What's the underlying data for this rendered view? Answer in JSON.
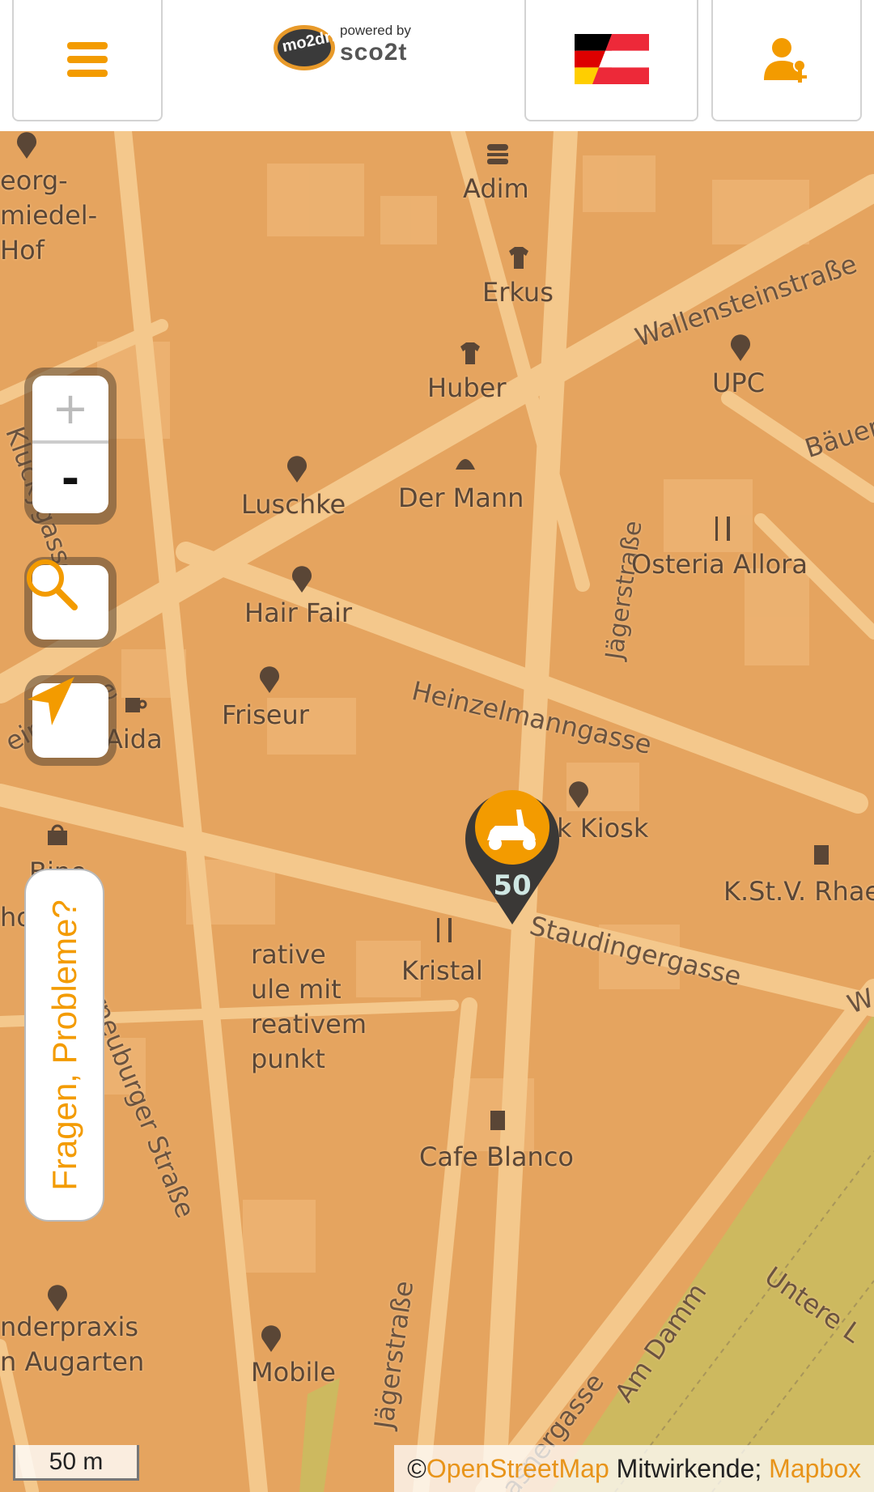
{
  "topbar": {
    "menu_icon": "hamburger-menu-icon",
    "logo": {
      "brand": "mo2drive",
      "powered_by": "powered by",
      "partner": "sco2t"
    },
    "language_icon": "flag-de-at-icon",
    "account_icon": "user-key-icon"
  },
  "colors": {
    "accent": "#f39b00",
    "map_block": "#e5a45f",
    "map_road": "#f4c88c",
    "park": "#cdb95f"
  },
  "map": {
    "pois": [
      {
        "name": "Adim"
      },
      {
        "name": "Erkus"
      },
      {
        "name": "Huber"
      },
      {
        "name": "UPC"
      },
      {
        "name": "Luschke"
      },
      {
        "name": "Der Mann"
      },
      {
        "name": "Osteria Allora"
      },
      {
        "name": "Hair Fair"
      },
      {
        "name": "Friseur"
      },
      {
        "name": "Aida"
      },
      {
        "name": "k Kiosk"
      },
      {
        "name": "K.St.V. Rhae"
      },
      {
        "name": "Kristal"
      },
      {
        "name": "Cafe Blanco"
      },
      {
        "name": "Mobile"
      }
    ],
    "text_fragments": {
      "georg": "eorg-\nmiedel-\nHof",
      "kreative": "rative\nule mit\nreativem\npunkt",
      "kinderpraxis": "nderpraxis\nn Augarten",
      "bine": "Bine",
      "ho": "ho"
    },
    "streets": {
      "wallenstein": "Wallensteinstraße",
      "baeuerle": "Bäuer",
      "jaeger1": "Jägerstraße",
      "jaeger2": "Jägerstraße",
      "heinzelmann": "Heinzelmanngasse",
      "staudinger": "Staudingergasse",
      "klucky": "Kluckygasse",
      "klosterneuburger": "rneuburger Straße",
      "treustrasse": "einstraße",
      "am_damm": "Am Damm",
      "untere": "Untere L",
      "wasner": "asnergasse",
      "w": "W"
    },
    "vehicle_marker": {
      "icon": "scooter-icon",
      "battery": "50"
    },
    "zoom_in": "+",
    "zoom_out": "-",
    "search_icon": "search-icon",
    "locate_icon": "locate-arrow-icon",
    "feedback_label": "Fragen, Probleme?",
    "scale_label": "50 m",
    "attribution": {
      "prefix": "© ",
      "osm": "OpenStreetMap",
      "middle": " Mitwirkende; ",
      "mapbox": "Mapbox"
    }
  }
}
